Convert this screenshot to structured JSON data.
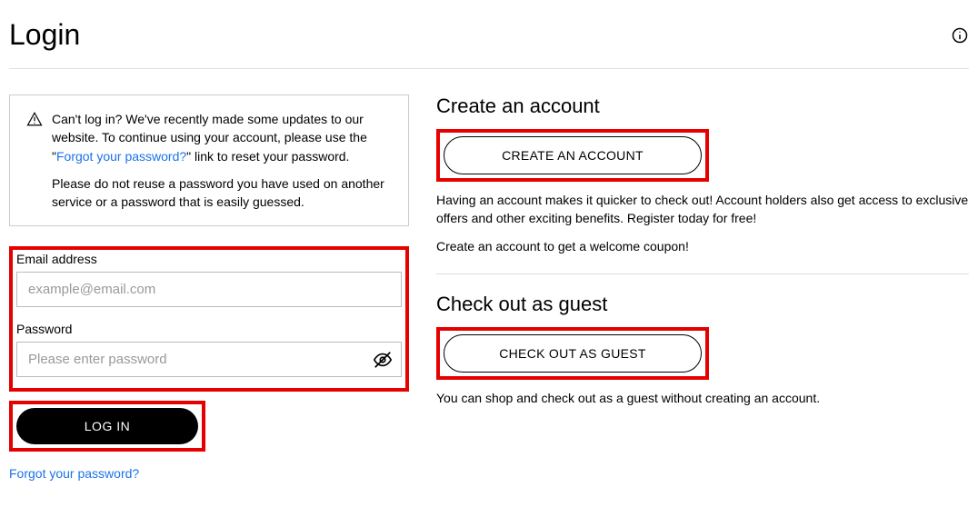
{
  "header": {
    "title": "Login"
  },
  "notice": {
    "line1_prefix": "Can't log in? We've recently made some updates to our website. To continue using your account, please use the \"",
    "link_text": "Forgot your password?",
    "line1_suffix": "\" link to reset your password.",
    "line2": "Please do not reuse a password you have used on another service or a password that is easily guessed."
  },
  "form": {
    "email": {
      "label": "Email address",
      "placeholder": "example@email.com"
    },
    "password": {
      "label": "Password",
      "placeholder": "Please enter password"
    },
    "submit": "LOG IN",
    "forgot": "Forgot your password?"
  },
  "create": {
    "title": "Create an account",
    "button": "CREATE AN ACCOUNT",
    "desc1": "Having an account makes it quicker to check out! Account holders also get access to exclusive offers and other exciting benefits. Register today for free!",
    "desc2": "Create an account to get a welcome coupon!"
  },
  "guest": {
    "title": "Check out as guest",
    "button": "CHECK OUT AS GUEST",
    "desc": "You can shop and check out as a guest without creating an account."
  }
}
